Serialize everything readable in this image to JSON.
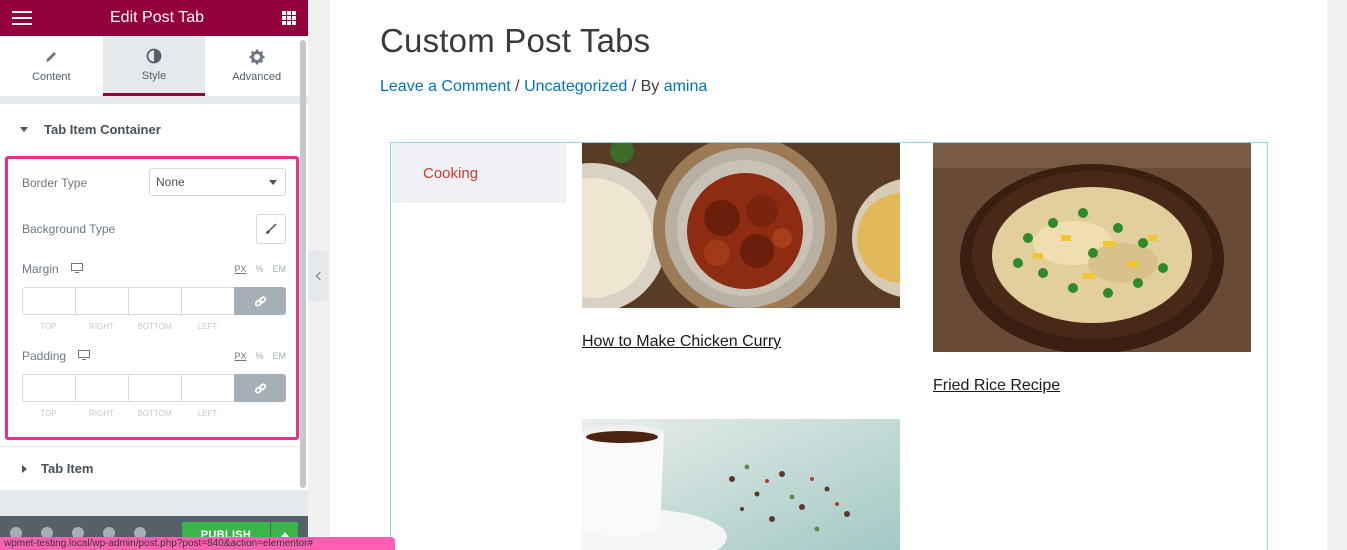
{
  "panel": {
    "header_title": "Edit Post Tab",
    "tabs": [
      {
        "label": "Content",
        "icon": "pencil-icon"
      },
      {
        "label": "Style",
        "icon": "half-circle-icon",
        "active": true
      },
      {
        "label": "Advanced",
        "icon": "gear-icon"
      }
    ],
    "section_open": "Tab Item Container",
    "section_closed": "Tab Item",
    "border_type_label": "Border Type",
    "border_type_value": "None",
    "background_type_label": "Background Type",
    "margin_label": "Margin",
    "padding_label": "Padding",
    "unit_px": "PX",
    "unit_pct": "%",
    "unit_em": "EM",
    "dim_labels": [
      "TOP",
      "RIGHT",
      "BOTTOM",
      "LEFT"
    ],
    "publish_label": "PUBLISH",
    "status_url": "wpmet-testing.local/wp-admin/post.php?post=840&action=elementor#",
    "highlight_color": "#ea2f8a",
    "brand_color": "#93003c"
  },
  "preview": {
    "post_title": "Custom Post Tabs",
    "meta_comment": "Leave a Comment",
    "meta_sep1": " / ",
    "meta_category": "Uncategorized",
    "meta_sep2": " / By ",
    "meta_author": "amina",
    "tab_label": "Cooking",
    "posts": [
      {
        "title": "How to Make Chicken Curry",
        "image": "chicken-curry-photo"
      },
      {
        "title": "Fried Rice Recipe",
        "image": "fried-rice-photo"
      },
      {
        "title": "",
        "image": "tea-cup-photo"
      }
    ]
  }
}
